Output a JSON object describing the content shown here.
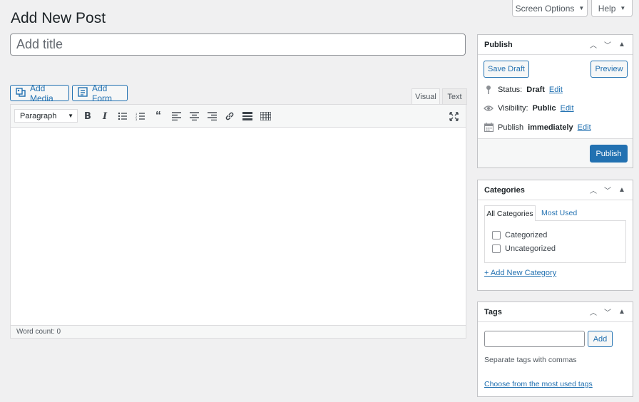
{
  "header": {
    "title": "Add New Post",
    "screen_options": "Screen Options",
    "help": "Help"
  },
  "title_field": {
    "placeholder": "Add title",
    "value": ""
  },
  "media": {
    "add_media": "Add Media",
    "add_form": "Add Form"
  },
  "editor": {
    "tabs": [
      "Visual",
      "Text"
    ],
    "format": "Paragraph",
    "word_count": "Word count: 0"
  },
  "publish": {
    "title": "Publish",
    "save_draft": "Save Draft",
    "preview": "Preview",
    "status_label": "Status:",
    "status_value": "Draft",
    "visibility_label": "Visibility:",
    "visibility_value": "Public",
    "schedule_label": "Publish",
    "schedule_value": "immediately",
    "edit": "Edit",
    "publish_button": "Publish"
  },
  "categories": {
    "title": "Categories",
    "tabs": [
      "All Categories",
      "Most Used"
    ],
    "items": [
      "Categorized",
      "Uncategorized"
    ],
    "add_new": "+ Add New Category"
  },
  "tags": {
    "title": "Tags",
    "input_value": "",
    "add": "Add",
    "hint": "Separate tags with commas",
    "choose": "Choose from the most used tags"
  },
  "colors": {
    "accent": "#2271b1",
    "background": "#f0f0f1",
    "text": "#1d2327"
  }
}
